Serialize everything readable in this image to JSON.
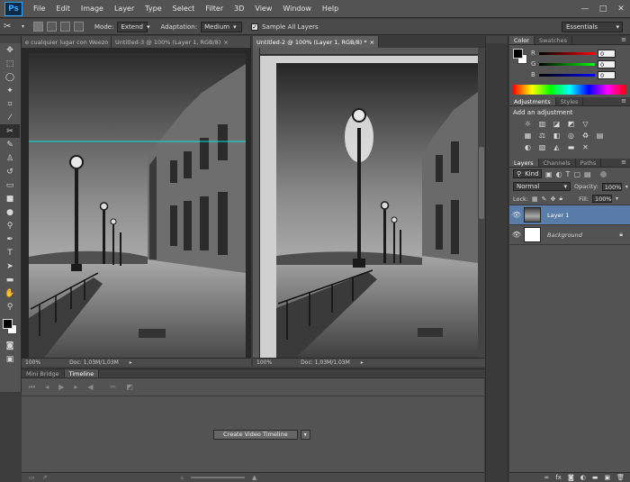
{
  "app": {
    "logo": "Ps"
  },
  "menu": [
    "File",
    "Edit",
    "Image",
    "Layer",
    "Type",
    "Select",
    "Filter",
    "3D",
    "View",
    "Window",
    "Help"
  ],
  "window_controls": {
    "minimize": "—",
    "maximize": "□",
    "close": "✕"
  },
  "options": {
    "mode_label": "Mode:",
    "mode_value": "Extend",
    "adaptation_label": "Adaptation:",
    "adaptation_value": "Medium",
    "sample_all_label": "Sample All Layers",
    "workspace": "Essentials"
  },
  "docs": {
    "tabs": [
      "e cualquier lugar con Weezo",
      "Untitled-3 @ 100% (Layer 1, RGB/8)",
      "Untitled-2 @ 100% (Layer 1, RGB/8) *"
    ],
    "left_zoom": "100%",
    "left_doc": "Doc: 1,03M/1,03M",
    "right_zoom": "100%",
    "right_doc": "Doc: 1,03M/1,03M"
  },
  "timeline": {
    "tabs": [
      "Mini Bridge",
      "Timeline"
    ],
    "create_button": "Create Video Timeline"
  },
  "color_panel": {
    "tabs": [
      "Color",
      "Swatches"
    ],
    "r_label": "R",
    "r_value": "0",
    "g_label": "G",
    "g_value": "0",
    "b_label": "B",
    "b_value": "0"
  },
  "adjustments": {
    "tabs": [
      "Adjustments",
      "Styles"
    ],
    "heading": "Add an adjustment"
  },
  "layers": {
    "tabs": [
      "Layers",
      "Channels",
      "Paths"
    ],
    "kind": "Kind",
    "blend": "Normal",
    "opacity_label": "Opacity:",
    "opacity_value": "100%",
    "lock_label": "Lock:",
    "fill_label": "Fill:",
    "fill_value": "100%",
    "items": [
      "Layer 1",
      "Background"
    ]
  },
  "colors": {
    "accent": "#5a7ca8",
    "guide": "#00e5e5"
  }
}
